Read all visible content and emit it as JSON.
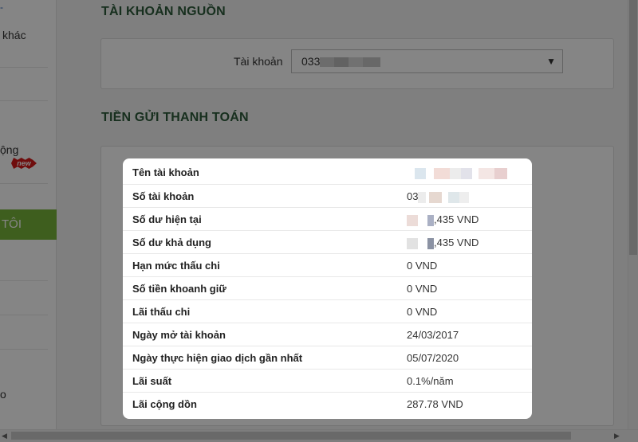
{
  "sidebar": {
    "items": [
      {
        "label": "khác"
      },
      {
        "label": "ộng"
      },
      {
        "label": "o"
      }
    ],
    "new_badge": "new",
    "green_button_label": "TÔI"
  },
  "source_account": {
    "section_title": "TÀI KHOẢN NGUỒN",
    "account_label": "Tài khoản",
    "account_value_prefix": "033"
  },
  "payment_deposit": {
    "section_title": "TIỀN GỬI THANH TOÁN"
  },
  "details": {
    "rows": [
      {
        "label": "Tên tài khoản",
        "value": ""
      },
      {
        "label": "Số tài khoản",
        "value": "03"
      },
      {
        "label": "Số dư hiện tại",
        "value": ",435 VND"
      },
      {
        "label": "Số dư khả dụng",
        "value": ",435 VND"
      },
      {
        "label": "Hạn mức thấu chi",
        "value": "0 VND"
      },
      {
        "label": "Số tiền khoanh giữ",
        "value": "0 VND"
      },
      {
        "label": "Lãi thấu chi",
        "value": "0 VND"
      },
      {
        "label": "Ngày mở tài khoản",
        "value": "24/03/2017"
      },
      {
        "label": "Ngày thực hiện giao dịch gần nhất",
        "value": "05/07/2020"
      },
      {
        "label": "Lãi suất",
        "value": "0.1%/năm"
      },
      {
        "label": "Lãi cộng dồn",
        "value": "287.78 VND"
      }
    ]
  },
  "colors": {
    "section_title": "#2c5a3a",
    "green_button": "#78b53a",
    "new_badge": "#d51a1a",
    "overlay": "rgba(0,0,0,0.48)"
  }
}
